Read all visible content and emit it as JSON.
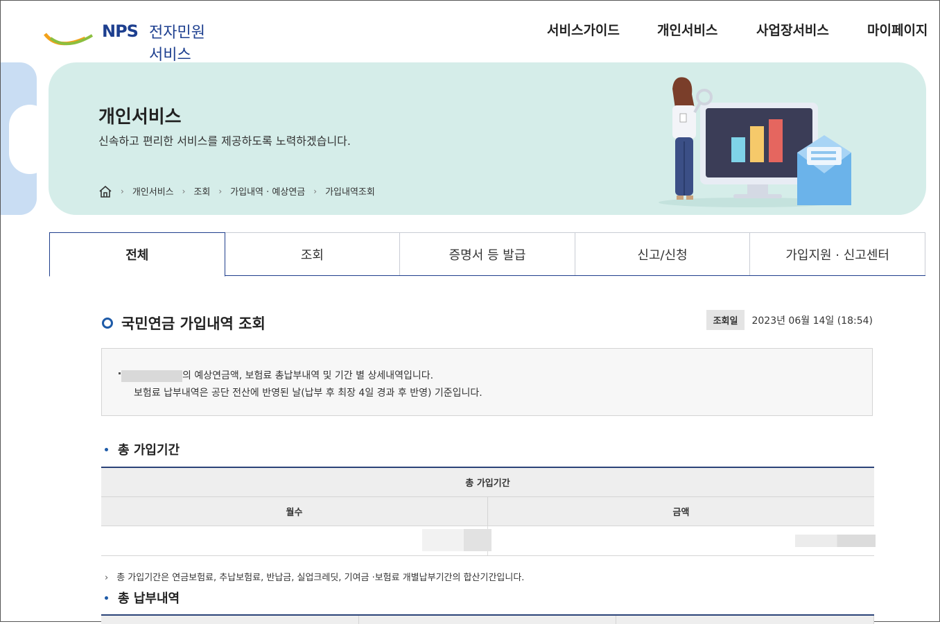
{
  "header": {
    "logo_mark": "NPS",
    "logo_text": "전자민원서비스",
    "nav": [
      "서비스가이드",
      "개인서비스",
      "사업장서비스",
      "마이페이지"
    ]
  },
  "banner": {
    "title": "개인서비스",
    "description": "신속하고 편리한 서비스를 제공하도록 노력하겠습니다.",
    "breadcrumb": [
      "개인서비스",
      "조회",
      "가입내역 · 예상연금",
      "가입내역조회"
    ]
  },
  "tabs": [
    {
      "label": "전체",
      "active": true
    },
    {
      "label": "조회",
      "active": false
    },
    {
      "label": "증명서 등 발급",
      "active": false
    },
    {
      "label": "신고/신청",
      "active": false
    },
    {
      "label": "가입지원 · 신고센터",
      "active": false
    }
  ],
  "section": {
    "title": "국민연금 가입내역 조회",
    "date_label": "조회일",
    "date_value": "2023년 06월 14일 (18:54)"
  },
  "notice": {
    "line1_suffix": "의 예상연금액, 보험료 총납부내역 및 기간 별 상세내역입니다.",
    "line2": "보험료 납부내역은 공단 전산에 반영된 날(납부 후 최장 4일 경과 후 반영) 기준입니다."
  },
  "total_period": {
    "heading": "총 가입기간",
    "table_header": "총 가입기간",
    "col_months": "월수",
    "col_amount": "금액",
    "footnote": "총 가입기간은 연금보험료, 추납보험료, 반납금, 실업크레딧, 기여금 ·보험료 개별납부기간의 합산기간입니다."
  },
  "total_payment": {
    "heading": "총 납부내역"
  },
  "colors": {
    "brand_navy": "#1d3f8f",
    "banner_bg": "#d5ede9",
    "accent_blue": "#1e5ba8"
  }
}
